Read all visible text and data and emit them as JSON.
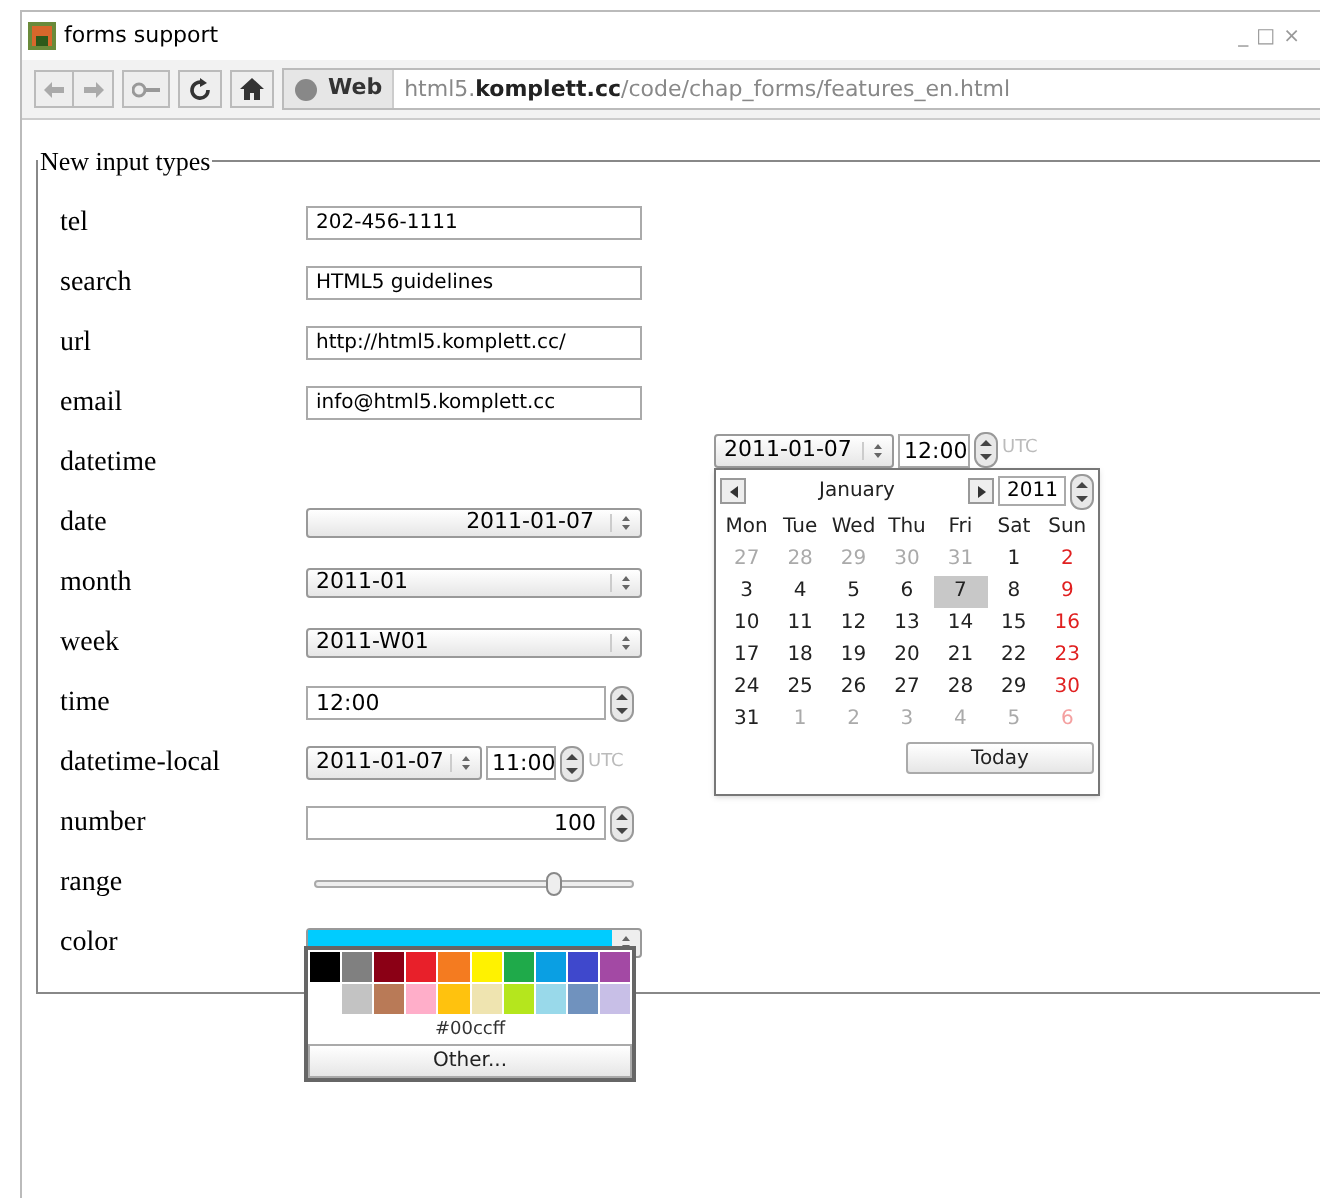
{
  "window": {
    "title": "forms support",
    "controls": [
      "_",
      "□",
      "×"
    ]
  },
  "toolbar": {
    "location_label": "Web",
    "url": "html5.**komplett.cc**/code/chap_forms/features_en.html"
  },
  "form": {
    "legend": "New input types",
    "fields": [
      {
        "label": "tel",
        "kind": "text",
        "value": "202-456-1111"
      },
      {
        "label": "search",
        "kind": "text",
        "value": "HTML5 guidelines"
      },
      {
        "label": "url",
        "kind": "text",
        "value": "http://html5.komplett.cc/"
      },
      {
        "label": "email",
        "kind": "text",
        "value": "info@html5.komplett.cc"
      },
      {
        "label": "datetime",
        "kind": "none"
      },
      {
        "label": "date",
        "kind": "select",
        "right_aligned": true,
        "value": "2011-01-07"
      },
      {
        "label": "month",
        "kind": "select",
        "right_aligned": false,
        "value": "2011-01"
      },
      {
        "label": "week",
        "kind": "select",
        "right_aligned": false,
        "value": "2011-W01"
      },
      {
        "label": "time",
        "kind": "spin",
        "right_aligned": false,
        "value": "12:00"
      },
      {
        "label": "datetime-local",
        "kind": "datetime",
        "date": "2011-01-07",
        "time": "11:00",
        "zone": "UTC"
      },
      {
        "label": "number",
        "kind": "spin",
        "right_aligned": true,
        "value": "100"
      },
      {
        "label": "range",
        "kind": "range",
        "level": 0.75
      },
      {
        "label": "color",
        "kind": "color",
        "color": "#00ccff"
      }
    ]
  },
  "datetime_popup": {
    "date": "2011-01-07",
    "time": "12:00",
    "zone": "UTC",
    "month": "January",
    "year": "2011",
    "weekdays": [
      "Mon",
      "Tue",
      "Wed",
      "Thu",
      "Fri",
      "Sat",
      "Sun"
    ],
    "weeks": [
      [
        {
          "day": "27",
          "outside": true,
          "selected": false
        },
        {
          "day": "28",
          "outside": true,
          "selected": false
        },
        {
          "day": "29",
          "outside": true,
          "selected": false
        },
        {
          "day": "30",
          "outside": true,
          "selected": false
        },
        {
          "day": "31",
          "outside": true,
          "selected": false
        },
        {
          "day": "1",
          "outside": false,
          "selected": false
        },
        {
          "day": "2",
          "outside": false,
          "selected": false
        }
      ],
      [
        {
          "day": "3",
          "outside": false,
          "selected": false
        },
        {
          "day": "4",
          "outside": false,
          "selected": false
        },
        {
          "day": "5",
          "outside": false,
          "selected": false
        },
        {
          "day": "6",
          "outside": false,
          "selected": false
        },
        {
          "day": "7",
          "outside": false,
          "selected": true
        },
        {
          "day": "8",
          "outside": false,
          "selected": false
        },
        {
          "day": "9",
          "outside": false,
          "selected": false
        }
      ],
      [
        {
          "day": "10",
          "outside": false,
          "selected": false
        },
        {
          "day": "11",
          "outside": false,
          "selected": false
        },
        {
          "day": "12",
          "outside": false,
          "selected": false
        },
        {
          "day": "13",
          "outside": false,
          "selected": false
        },
        {
          "day": "14",
          "outside": false,
          "selected": false
        },
        {
          "day": "15",
          "outside": false,
          "selected": false
        },
        {
          "day": "16",
          "outside": false,
          "selected": false
        }
      ],
      [
        {
          "day": "17",
          "outside": false,
          "selected": false
        },
        {
          "day": "18",
          "outside": false,
          "selected": false
        },
        {
          "day": "19",
          "outside": false,
          "selected": false
        },
        {
          "day": "20",
          "outside": false,
          "selected": false
        },
        {
          "day": "21",
          "outside": false,
          "selected": false
        },
        {
          "day": "22",
          "outside": false,
          "selected": false
        },
        {
          "day": "23",
          "outside": false,
          "selected": false
        }
      ],
      [
        {
          "day": "24",
          "outside": false,
          "selected": false
        },
        {
          "day": "25",
          "outside": false,
          "selected": false
        },
        {
          "day": "26",
          "outside": false,
          "selected": false
        },
        {
          "day": "27",
          "outside": false,
          "selected": false
        },
        {
          "day": "28",
          "outside": false,
          "selected": false
        },
        {
          "day": "29",
          "outside": false,
          "selected": false
        },
        {
          "day": "30",
          "outside": false,
          "selected": false
        }
      ],
      [
        {
          "day": "31",
          "outside": false,
          "selected": false
        },
        {
          "day": "1",
          "outside": true,
          "selected": false
        },
        {
          "day": "2",
          "outside": true,
          "selected": false
        },
        {
          "day": "3",
          "outside": true,
          "selected": false
        },
        {
          "day": "4",
          "outside": true,
          "selected": false
        },
        {
          "day": "5",
          "outside": true,
          "selected": false
        },
        {
          "day": "6",
          "outside": true,
          "selected": false
        }
      ]
    ],
    "today_button": "Today"
  },
  "color_popup": {
    "swatches": [
      {
        "color": "#000000"
      },
      {
        "color": "#808080"
      },
      {
        "color": "#8b0015"
      },
      {
        "color": "#e8202a"
      },
      {
        "color": "#f47b20"
      },
      {
        "color": "#fff200"
      },
      {
        "color": "#1faa4a"
      },
      {
        "color": "#0a9fe3"
      },
      {
        "color": "#3f48cc"
      },
      {
        "color": "#a349a4"
      },
      {
        "color": "#c3c3c3"
      },
      {
        "color": "#b97a57"
      },
      {
        "color": "#ffaec9"
      },
      {
        "color": "#ffc20e"
      },
      {
        "color": "#efe4b0"
      },
      {
        "color": "#b5e61d"
      },
      {
        "color": "#99d9ea"
      },
      {
        "color": "#7092be"
      },
      {
        "color": "#c8bfe7"
      }
    ],
    "value": "#00ccff",
    "other_button": "Other..."
  }
}
